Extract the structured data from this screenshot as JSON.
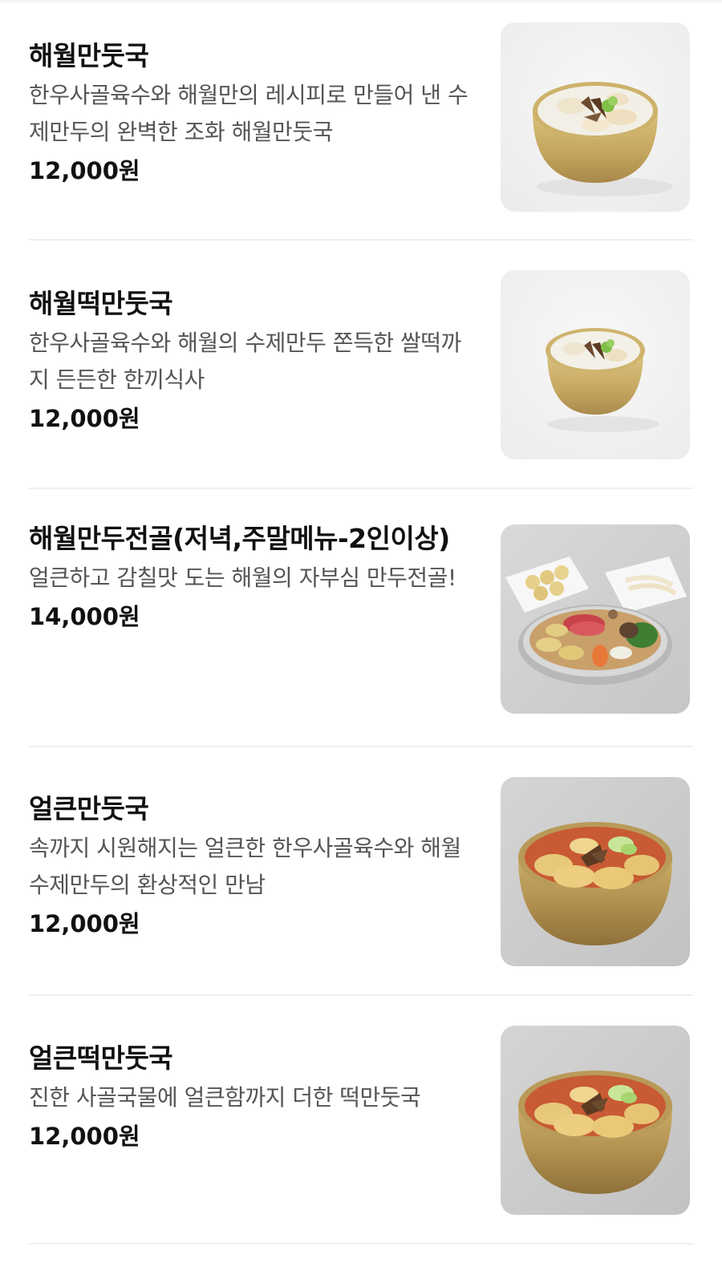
{
  "menu": {
    "items": [
      {
        "name": "해월만둣국",
        "desc": "한우사골육수와 해월만의 레시피로 만들어 낸 수제만두의 완벽한 조화 해월만둣국",
        "price": "12,000원",
        "image_icon": "dumpling-soup-photo"
      },
      {
        "name": "해월떡만둣국",
        "desc": "한우사골육수와 해월의 수제만두 쫀득한 쌀떡까지 든든한 한끼식사",
        "price": "12,000원",
        "image_icon": "rice-cake-dumpling-soup-photo"
      },
      {
        "name": "해월만두전골(저녁,주말메뉴-2인이상)",
        "desc": "얼큰하고 감칠맛 도는 해월의 자부심 만두전골!",
        "price": "14,000원",
        "image_icon": "dumpling-hotpot-photo"
      },
      {
        "name": "얼큰만둣국",
        "desc": "속까지 시원해지는 얼큰한 한우사골육수와 해월수제만두의 환상적인 만남",
        "price": "12,000원",
        "image_icon": "spicy-dumpling-soup-photo"
      },
      {
        "name": "얼큰떡만둣국",
        "desc": "진한 사골국물에 얼큰함까지 더한 떡만둣국",
        "price": "12,000원",
        "image_icon": "spicy-rice-cake-dumpling-soup-photo"
      }
    ]
  }
}
